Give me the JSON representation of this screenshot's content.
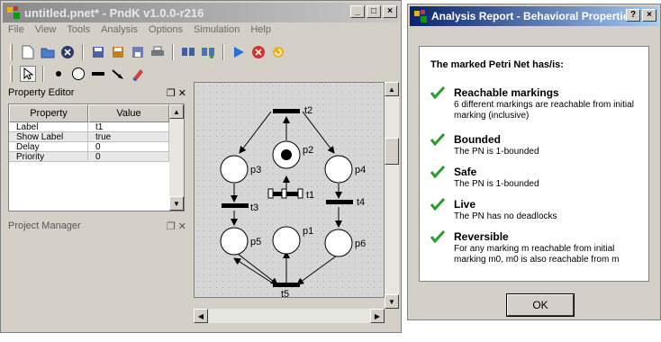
{
  "main_window": {
    "title": "untitled.pnet* - PndK v1.0.0-r216",
    "menu": [
      "File",
      "View",
      "Tools",
      "Analysis",
      "Options",
      "Simulation",
      "Help"
    ],
    "property_editor": {
      "title": "Property Editor",
      "ctrl_glyphs": "❐ ✕",
      "columns": [
        "Property",
        "Value"
      ],
      "rows": [
        {
          "property": "Label",
          "value": "t1"
        },
        {
          "property": "Show Label",
          "value": "true"
        },
        {
          "property": "Delay",
          "value": "0"
        },
        {
          "property": "Priority",
          "value": "0"
        }
      ]
    },
    "project_manager": {
      "title": "Project Manager",
      "ctrl_glyphs": "❐ ✕"
    },
    "petri_net": {
      "place_labels": [
        "p1",
        "p2",
        "p3",
        "p4",
        "p5",
        "p6"
      ],
      "transition_labels": [
        "t1",
        "t2",
        "t3",
        "t4",
        "t5"
      ]
    }
  },
  "dialog": {
    "title": "Analysis Report - Behavioral Properties",
    "heading": "The marked Petri Net has/is:",
    "properties": [
      {
        "name": "Reachable markings",
        "description": "6 different markings are reachable from initial marking (inclusive)"
      },
      {
        "name": "Bounded",
        "description": "The PN is 1-bounded"
      },
      {
        "name": "Safe",
        "description": "The PN is 1-bounded"
      },
      {
        "name": "Live",
        "description": "The PN has no deadlocks"
      },
      {
        "name": "Reversible",
        "description": "For any marking m reachable from initial marking m0, m0 is also reachable from m"
      }
    ],
    "ok_label": "OK"
  },
  "colors": {
    "title_active": "#0a246a",
    "title_inactive": "#8a8a8a",
    "check_green": "#2e9a2e"
  }
}
